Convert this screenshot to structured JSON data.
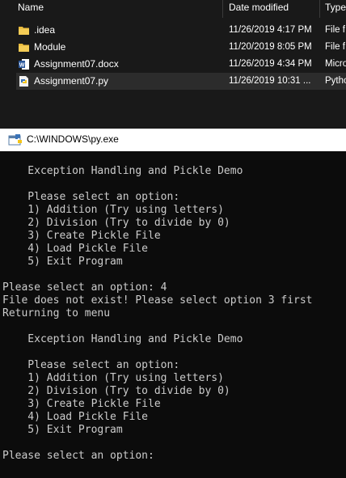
{
  "explorer": {
    "headers": {
      "name": "Name",
      "date_modified": "Date modified",
      "type": "Type"
    },
    "files": [
      {
        "name": ".idea",
        "date": "11/26/2019 4:17 PM",
        "type": "File f",
        "icon": "folder-icon",
        "selected": false
      },
      {
        "name": "Module",
        "date": "11/20/2019 8:05 PM",
        "type": "File f",
        "icon": "folder-icon",
        "selected": false
      },
      {
        "name": "Assignment07.docx",
        "date": "11/26/2019 4:34 PM",
        "type": "Micro",
        "icon": "word-document-icon",
        "selected": false
      },
      {
        "name": "Assignment07.py",
        "date": "11/26/2019 10:31 ...",
        "type": "Pytho",
        "icon": "python-file-icon",
        "selected": true
      }
    ]
  },
  "console_window": {
    "title": "C:\\WINDOWS\\py.exe",
    "lines": [
      "",
      "    Exception Handling and Pickle Demo",
      "",
      "    Please select an option:",
      "    1) Addition (Try using letters)",
      "    2) Division (Try to divide by 0)",
      "    3) Create Pickle File",
      "    4) Load Pickle File",
      "    5) Exit Program",
      "",
      "Please select an option: 4",
      "File does not exist! Please select option 3 first",
      "Returning to menu",
      "",
      "    Exception Handling and Pickle Demo",
      "",
      "    Please select an option:",
      "    1) Addition (Try using letters)",
      "    2) Division (Try to divide by 0)",
      "    3) Create Pickle File",
      "    4) Load Pickle File",
      "    5) Exit Program",
      "",
      "Please select an option:"
    ]
  },
  "colors": {
    "explorer_bg": "#191919",
    "console_bg": "#0c0c0c",
    "console_text": "#cccccc",
    "selected_row": "#2c2c2c",
    "folder": "#e8b93a"
  }
}
